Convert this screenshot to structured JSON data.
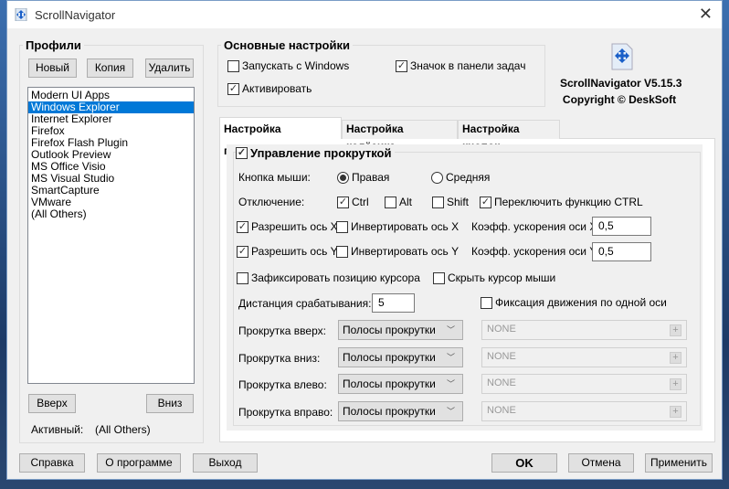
{
  "window": {
    "title": "ScrollNavigator",
    "close": "✕"
  },
  "profiles": {
    "title": "Профили",
    "new": "Новый",
    "copy": "Копия",
    "delete": "Удалить",
    "items": [
      "Modern UI Apps",
      "Windows Explorer",
      "Internet Explorer",
      "Firefox",
      "Firefox Flash Plugin",
      "Outlook Preview",
      "MS Office Visio",
      "MS Visual Studio",
      "SmartCapture",
      "VMware",
      "(All Others)"
    ],
    "selected_index": 1,
    "up": "Вверх",
    "down": "Вниз",
    "active_label": "Активный:",
    "active_value": "(All Others)"
  },
  "main": {
    "title": "Основные настройки",
    "start_with_windows": "Запускать с Windows",
    "start_with_windows_checked": false,
    "tray_icon": "Значок в панели задач",
    "tray_icon_checked": true,
    "activate": "Активировать",
    "activate_checked": true
  },
  "about": {
    "version": "ScrollNavigator V5.15.3",
    "copyright": "Copyright © DeskSoft"
  },
  "tabs": [
    "Настройка прокрутки",
    "Настройка колёсика",
    "Настройка кнопок"
  ],
  "scroll": {
    "group": "Управление прокруткой",
    "mouse_button_label": "Кнопка мыши:",
    "right": "Правая",
    "middle": "Средняя",
    "selected": "Правая",
    "disable_label": "Отключение:",
    "ctrl": "Ctrl",
    "alt": "Alt",
    "shift": "Shift",
    "toggle_ctrl": "Переключить функцию CTRL",
    "allow_x": "Разрешить ось X",
    "invert_x": "Инвертировать ось X",
    "accel_x_label": "Коэфф. ускорения оси X",
    "accel_x": "0,5",
    "allow_y": "Разрешить ось Y",
    "invert_y": "Инвертировать ось Y",
    "accel_y_label": "Коэфф. ускорения оси Y",
    "accel_y": "0,5",
    "fix_cursor": "Зафиксировать позицию курсора",
    "hide_cursor": "Скрыть курсор мыши",
    "distance_label": "Дистанция срабатывания:",
    "distance": "5",
    "single_axis": "Фиксация движения по одной оси",
    "rows": [
      {
        "label": "Прокрутка вверх:",
        "mode": "Полосы прокрутки",
        "hotkey": "NONE"
      },
      {
        "label": "Прокрутка вниз:",
        "mode": "Полосы прокрутки",
        "hotkey": "NONE"
      },
      {
        "label": "Прокрутка влево:",
        "mode": "Полосы прокрутки",
        "hotkey": "NONE"
      },
      {
        "label": "Прокрутка вправо:",
        "mode": "Полосы прокрутки",
        "hotkey": "NONE"
      }
    ]
  },
  "footer": {
    "help": "Справка",
    "about": "О программе",
    "exit": "Выход",
    "ok": "OK",
    "cancel": "Отмена",
    "apply": "Применить"
  }
}
